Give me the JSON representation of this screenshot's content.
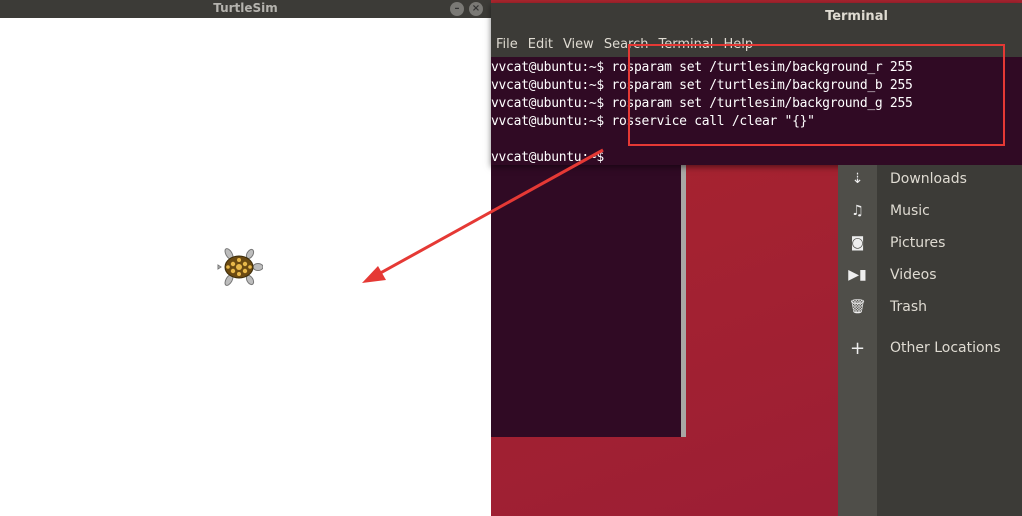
{
  "turtlesim": {
    "title": "TurtleSim",
    "background": "#ffffff"
  },
  "terminal": {
    "title": "Terminal",
    "menu": [
      "File",
      "Edit",
      "View",
      "Search",
      "Terminal",
      "Help"
    ],
    "prompt": "vvcat@ubuntu:~$",
    "commands": [
      "rosparam set /turtlesim/background_r 255",
      "rosparam set /turtlesim/background_b 255",
      "rosparam set /turtlesim/background_g 255",
      "rosservice call /clear \"{}\"",
      "",
      ""
    ]
  },
  "files_sidebar": {
    "items": [
      {
        "label": "Downloads",
        "icon": "download-icon"
      },
      {
        "label": "Music",
        "icon": "music-icon"
      },
      {
        "label": "Pictures",
        "icon": "camera-icon"
      },
      {
        "label": "Videos",
        "icon": "video-icon"
      },
      {
        "label": "Trash",
        "icon": "trash-icon"
      },
      {
        "label": "Other Locations",
        "icon": "plus-icon"
      }
    ]
  },
  "annotation": {
    "color": "#e53935"
  }
}
